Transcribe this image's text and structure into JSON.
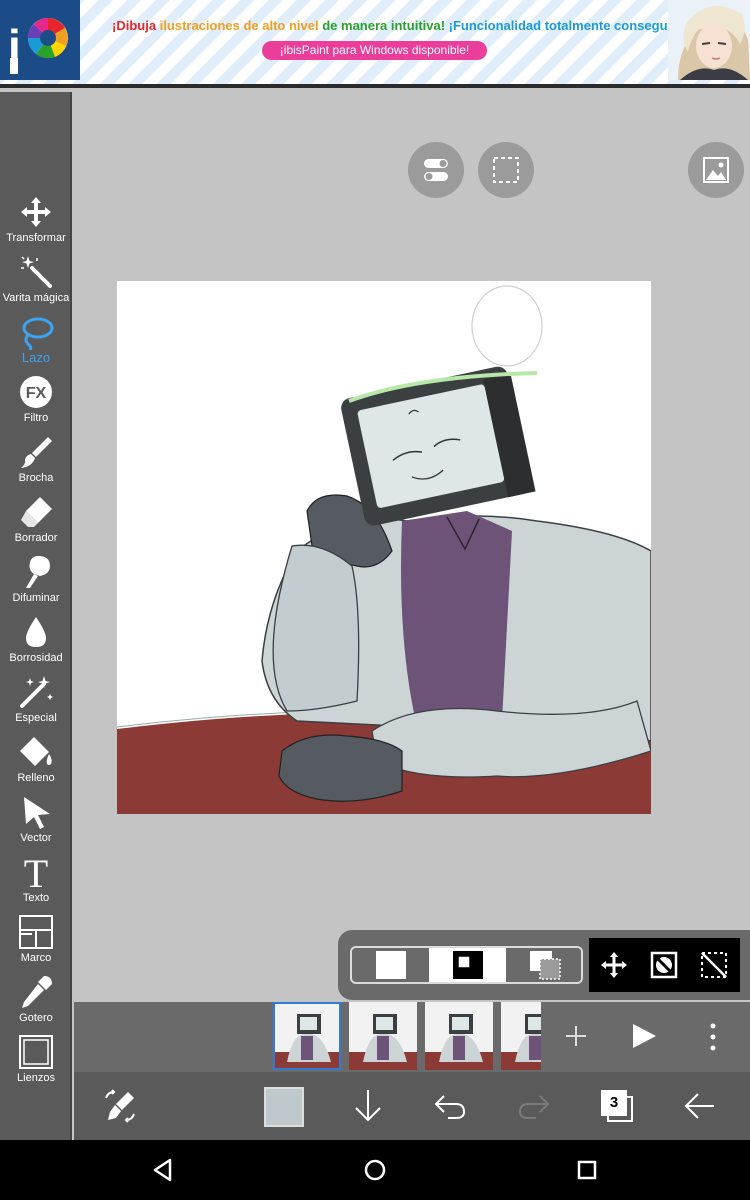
{
  "ad": {
    "logo_text": "iP",
    "headline_part1": "¡Dibuja ",
    "headline_part2": "ilustraciones de alto nivel ",
    "headline_part3": "de manera intuitiva! ",
    "headline_part4": "¡Funcionalidad totalmente conseguida!",
    "subline": "¡ibisPaint para Windows disponible!"
  },
  "toolbar": {
    "tools": [
      {
        "label": "Transformar",
        "icon": "move-arrows-icon"
      },
      {
        "label": "Varita mágica",
        "icon": "magic-wand-icon"
      },
      {
        "label": "Lazo",
        "icon": "lasso-icon",
        "active": true
      },
      {
        "label": "Filtro",
        "icon": "fx-icon"
      },
      {
        "label": "Brocha",
        "icon": "brush-icon"
      },
      {
        "label": "Borrador",
        "icon": "eraser-icon"
      },
      {
        "label": "Difuminar",
        "icon": "smudge-icon"
      },
      {
        "label": "Borrosidad",
        "icon": "blur-drop-icon"
      },
      {
        "label": "Especial",
        "icon": "sparkle-wand-icon"
      },
      {
        "label": "Relleno",
        "icon": "fill-bucket-icon"
      },
      {
        "label": "Vector",
        "icon": "vector-cursor-icon"
      },
      {
        "label": "Texto",
        "icon": "text-icon"
      },
      {
        "label": "Marco",
        "icon": "frame-divider-icon"
      },
      {
        "label": "Gotero",
        "icon": "eyedropper-icon"
      },
      {
        "label": "Lienzos",
        "icon": "canvas-icon"
      }
    ]
  },
  "bottombar": {
    "layer_count": "3",
    "current_color": "#bfc9cc"
  },
  "colors": {
    "accent": "#3da3f0",
    "toolbar_bg": "#5a5a5a",
    "canvas_bg": "#c4c4c4"
  }
}
